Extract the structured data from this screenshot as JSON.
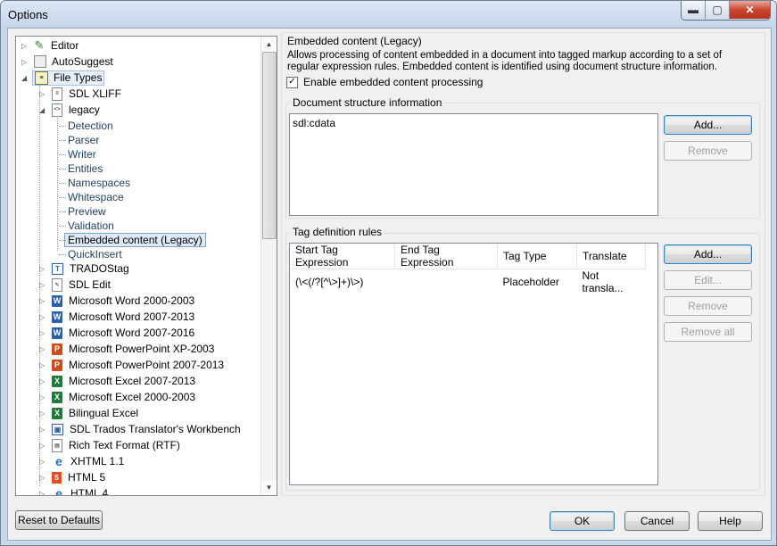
{
  "window": {
    "title": "Options",
    "minimize": "▬",
    "maximize": "▢",
    "close": "✕"
  },
  "tree": {
    "top_nodes": [
      {
        "label": "Editor",
        "icon": "pencil-icon"
      },
      {
        "label": "AutoSuggest",
        "icon": "autosuggest-icon"
      },
      {
        "label": "File Types",
        "icon": "file-types-icon"
      }
    ],
    "file_types": [
      {
        "label": "SDL XLIFF",
        "icon": "doc-icon"
      },
      {
        "label": "legacy",
        "icon": "doc-icon"
      }
    ],
    "legacy_children": [
      "Detection",
      "Parser",
      "Writer",
      "Entities",
      "Namespaces",
      "Whitespace",
      "Preview",
      "Validation",
      "Embedded content (Legacy)",
      "QuickInsert"
    ],
    "more_file_types": [
      {
        "label": "TRADOStag",
        "icon": "tag-icon",
        "glyph": "T"
      },
      {
        "label": "SDL Edit",
        "icon": "pencil-doc-icon",
        "glyph": "✎"
      },
      {
        "label": "Microsoft Word 2000-2003",
        "icon": "word-icon",
        "glyph": "W"
      },
      {
        "label": "Microsoft Word 2007-2013",
        "icon": "word-icon",
        "glyph": "W"
      },
      {
        "label": "Microsoft Word 2007-2016",
        "icon": "word-icon",
        "glyph": "W"
      },
      {
        "label": "Microsoft PowerPoint XP-2003",
        "icon": "powerpoint-icon",
        "glyph": "P"
      },
      {
        "label": "Microsoft PowerPoint 2007-2013",
        "icon": "powerpoint-icon",
        "glyph": "P"
      },
      {
        "label": "Microsoft Excel 2007-2013",
        "icon": "excel-icon",
        "glyph": "X"
      },
      {
        "label": "Microsoft Excel 2000-2003",
        "icon": "excel-icon",
        "glyph": "X"
      },
      {
        "label": "Bilingual Excel",
        "icon": "excel-icon",
        "glyph": "X"
      },
      {
        "label": "SDL Trados Translator's Workbench",
        "icon": "workbench-icon",
        "glyph": "▣"
      },
      {
        "label": "Rich Text Format (RTF)",
        "icon": "rtf-icon",
        "glyph": "▤"
      },
      {
        "label": "XHTML 1.1",
        "icon": "xhtml-icon",
        "glyph": "e"
      },
      {
        "label": "HTML 5",
        "icon": "html5-icon",
        "glyph": "5"
      },
      {
        "label": "HTML 4",
        "icon": "html4-icon",
        "glyph": "e"
      }
    ]
  },
  "embedded": {
    "group_title": "Embedded content (Legacy)",
    "description": "Allows processing of content embedded in a document into tagged markup according to a set of regular expression rules. Embedded content is identified using document structure information.",
    "checkbox_label": "Enable embedded content processing",
    "checkbox_checked": true
  },
  "doc_structure": {
    "title": "Document structure information",
    "items": [
      "sdl:cdata"
    ],
    "add_label": "Add...",
    "remove_label": "Remove"
  },
  "tag_rules": {
    "title": "Tag definition rules",
    "columns": [
      "Start Tag Expression",
      "End Tag Expression",
      "Tag Type",
      "Translate"
    ],
    "rows": [
      [
        "(\\<(/?[^\\>]+)\\>)",
        "",
        "Placeholder",
        "Not transla..."
      ]
    ],
    "add_label": "Add...",
    "edit_label": "Edit...",
    "remove_label": "Remove",
    "remove_all_label": "Remove all"
  },
  "footer": {
    "reset_label": "Reset to Defaults",
    "ok_label": "OK",
    "cancel_label": "Cancel",
    "help_label": "Help"
  }
}
